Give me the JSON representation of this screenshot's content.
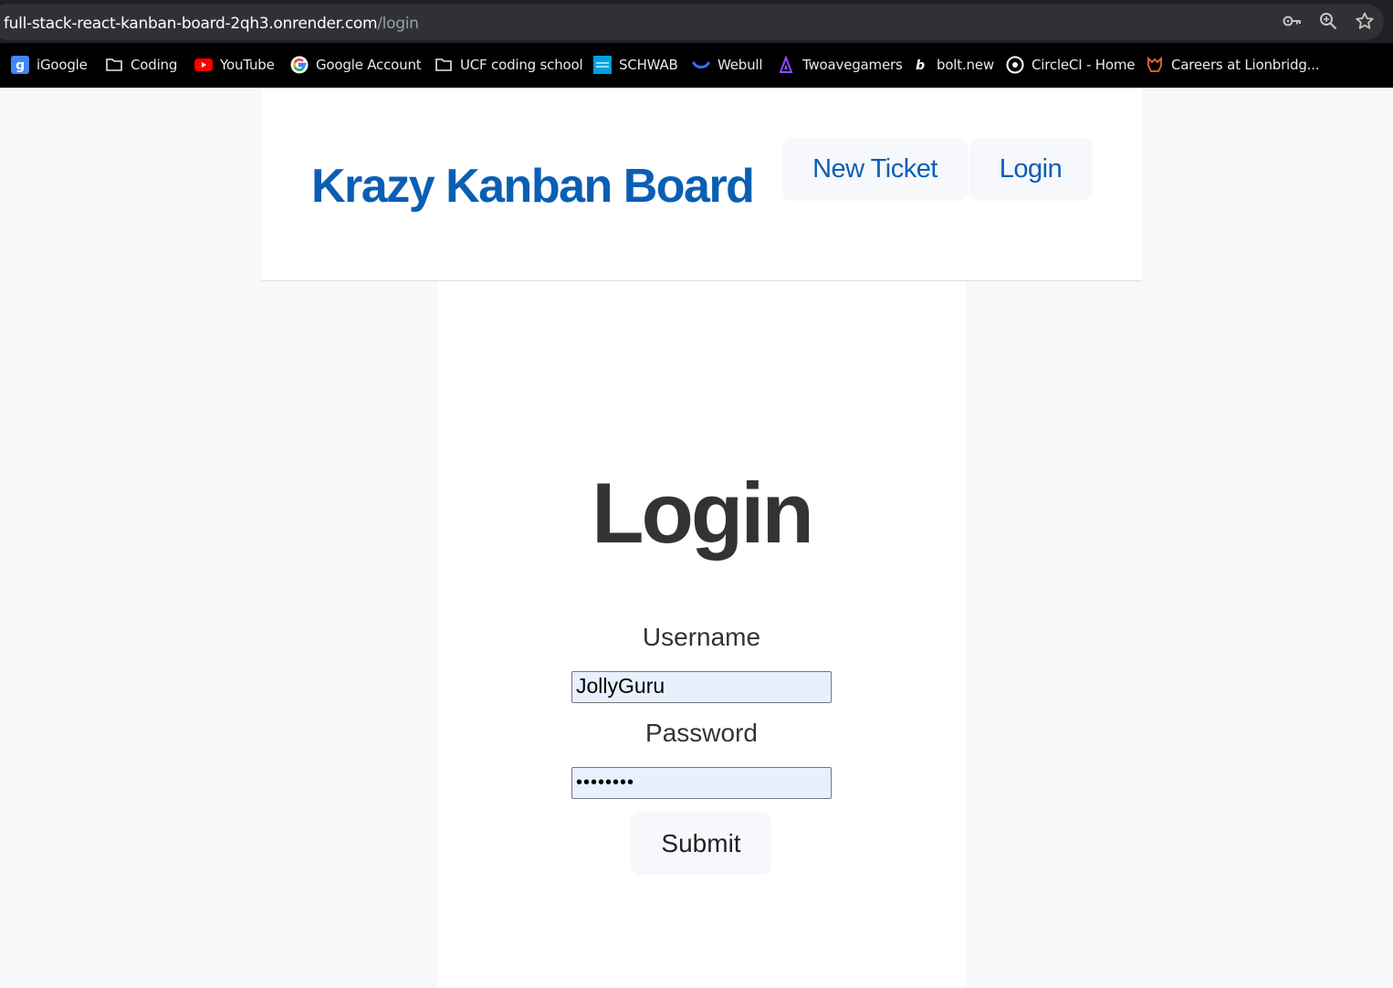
{
  "browser": {
    "url_host": "full-stack-react-kanban-board-2qh3.onrender.com",
    "url_path": "/login",
    "icons": [
      "key-icon",
      "zoom-icon",
      "star-icon"
    ],
    "bookmarks": [
      {
        "label": "iGoogle",
        "icon": "igoogle-icon"
      },
      {
        "label": "Coding",
        "icon": "folder-icon"
      },
      {
        "label": "YouTube",
        "icon": "youtube-icon"
      },
      {
        "label": "Google Account",
        "icon": "google-icon"
      },
      {
        "label": "UCF coding school",
        "icon": "folder-icon"
      },
      {
        "label": "SCHWAB",
        "icon": "schwab-icon"
      },
      {
        "label": "Webull",
        "icon": "webull-icon"
      },
      {
        "label": "Twoavegamers",
        "icon": "twoavegamers-icon"
      },
      {
        "label": "bolt.new",
        "icon": "bolt-icon"
      },
      {
        "label": "CircleCI - Home",
        "icon": "circleci-icon"
      },
      {
        "label": "Careers at Lionbridg...",
        "icon": "lionbridge-icon"
      }
    ]
  },
  "header": {
    "brand": "Krazy Kanban Board",
    "nav": {
      "new_ticket": "New Ticket",
      "login": "Login"
    }
  },
  "login": {
    "title": "Login",
    "username_label": "Username",
    "username_value": "JollyGuru",
    "password_label": "Password",
    "password_value": "••••••••",
    "submit_label": "Submit"
  },
  "colors": {
    "brand": "#0a5fb4",
    "page_bg": "#f8f9fb",
    "autofill_bg": "#e8f0fe"
  }
}
